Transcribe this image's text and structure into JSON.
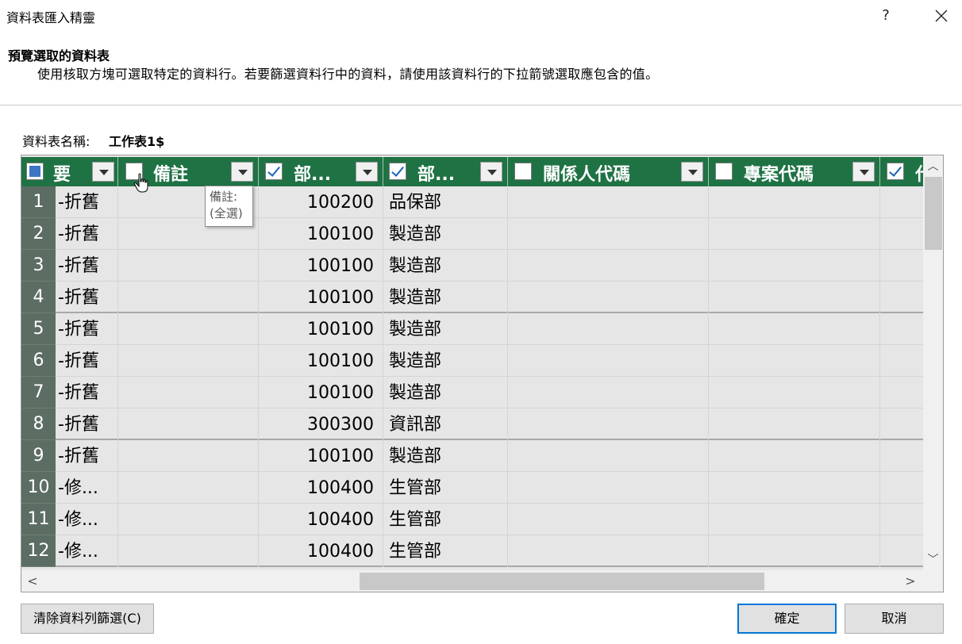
{
  "window": {
    "title": "資料表匯入精靈",
    "help_label": "?"
  },
  "header": {
    "heading": "預覽選取的資料表",
    "description": "使用核取方塊可選取特定的資料行。若要篩選資料行中的資料，請使用該資料行的下拉箭號選取應包含的值。"
  },
  "table_info": {
    "label": "資料表名稱:",
    "value": "工作表1$"
  },
  "columns": [
    {
      "label": "要",
      "checkbox": "partial"
    },
    {
      "label": "備註",
      "checkbox": "unchecked"
    },
    {
      "label": "部...",
      "checkbox": "checked"
    },
    {
      "label": "部...",
      "checkbox": "checked"
    },
    {
      "label": "關係人代碼",
      "checkbox": "unchecked"
    },
    {
      "label": "專案代碼",
      "checkbox": "unchecked"
    },
    {
      "label": "代",
      "checkbox": "checked"
    }
  ],
  "rows": [
    {
      "num": "1",
      "c1": "-折舊",
      "c2": "",
      "c3": "100200",
      "c4": "品保部"
    },
    {
      "num": "2",
      "c1": "-折舊",
      "c2": "",
      "c3": "100100",
      "c4": "製造部"
    },
    {
      "num": "3",
      "c1": "-折舊",
      "c2": "",
      "c3": "100100",
      "c4": "製造部"
    },
    {
      "num": "4",
      "c1": "-折舊",
      "c2": "",
      "c3": "100100",
      "c4": "製造部"
    },
    {
      "num": "5",
      "c1": "-折舊",
      "c2": "",
      "c3": "100100",
      "c4": "製造部"
    },
    {
      "num": "6",
      "c1": "-折舊",
      "c2": "",
      "c3": "100100",
      "c4": "製造部"
    },
    {
      "num": "7",
      "c1": "-折舊",
      "c2": "",
      "c3": "100100",
      "c4": "製造部"
    },
    {
      "num": "8",
      "c1": "-折舊",
      "c2": "",
      "c3": "300300",
      "c4": "資訊部"
    },
    {
      "num": "9",
      "c1": "-折舊",
      "c2": "",
      "c3": "100100",
      "c4": "製造部"
    },
    {
      "num": "10",
      "c1": "-修...",
      "c2": "",
      "c3": "100400",
      "c4": "生管部"
    },
    {
      "num": "11",
      "c1": "-修...",
      "c2": "",
      "c3": "100400",
      "c4": "生管部"
    },
    {
      "num": "12",
      "c1": "-修...",
      "c2": "",
      "c3": "100400",
      "c4": "生管部"
    }
  ],
  "tooltip": {
    "line1": "備註:",
    "line2": "(全選)"
  },
  "buttons": {
    "clear_filter": "清除資料列篩選(C)",
    "ok": "確定",
    "cancel": "取消"
  },
  "colors": {
    "header_bg": "#1f7244",
    "rownum_bg": "#5c6d64",
    "grid_bg": "#e6e6e6",
    "ok_border": "#0078d7"
  }
}
